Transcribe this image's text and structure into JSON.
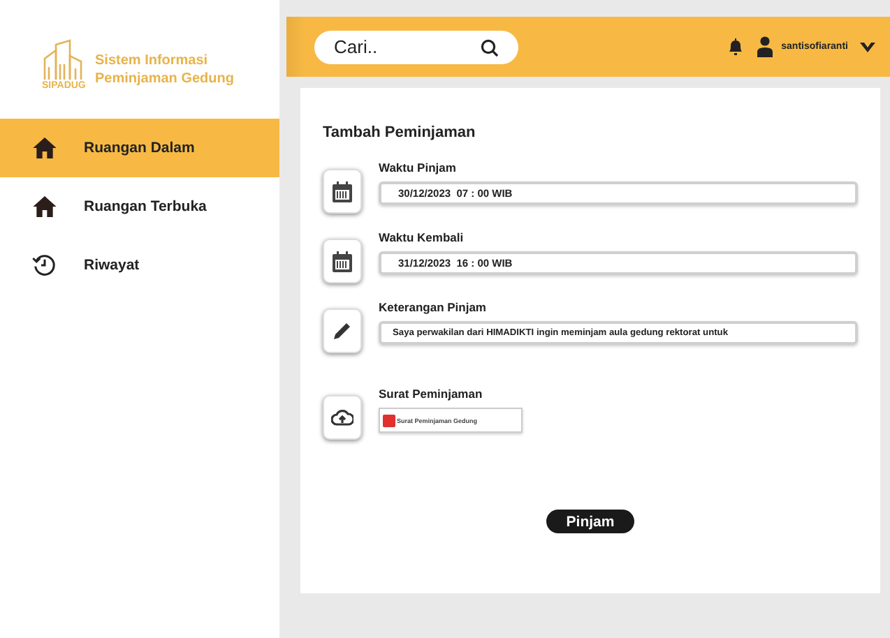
{
  "sidebar": {
    "logo_caption": "SIPADUG",
    "app_title": "Sistem Informasi Peminjaman Gedung",
    "items": [
      {
        "label": "Ruangan Dalam",
        "kind": "house",
        "selected": true
      },
      {
        "label": "Ruangan Terbuka",
        "kind": "house",
        "selected": false
      },
      {
        "label": "Riwayat",
        "kind": "history",
        "selected": false
      }
    ]
  },
  "header": {
    "search": {
      "placeholder": "Cari.."
    },
    "user": "santisofiaranti"
  },
  "form": {
    "title": "Tambah Peminjaman",
    "fields": [
      {
        "label": "Waktu Pinjam",
        "kind": "date",
        "value": "30/12/2023  07 : 00 WIB"
      },
      {
        "label": "Waktu Kembali",
        "kind": "date",
        "value": "31/12/2023  16 : 00 WIB"
      },
      {
        "label": "Keterangan Pinjam",
        "kind": "text",
        "value": "Saya perwakilan dari HIMADIKTI ingin meminjam aula gedung rektorat untuk"
      },
      {
        "label": "Surat Peminjaman",
        "kind": "file",
        "value": "Surat Peminjaman Gedung"
      }
    ],
    "submit": "Pinjam"
  }
}
